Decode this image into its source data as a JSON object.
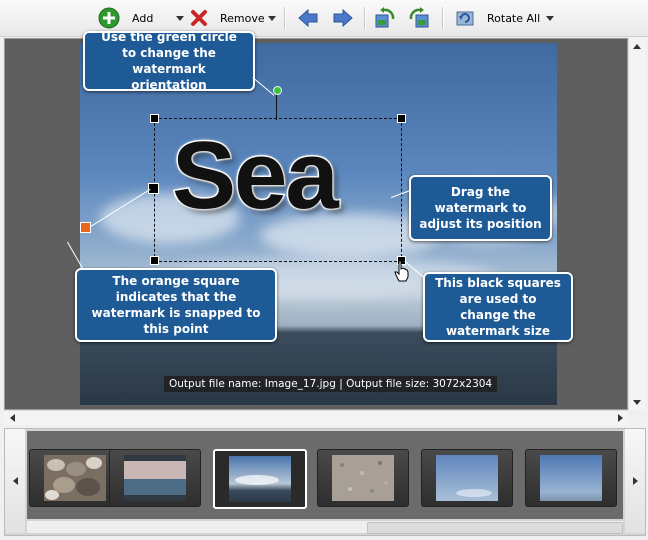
{
  "toolbar": {
    "add_label": "Add",
    "remove_label": "Remove",
    "rotate_all_label": "Rotate All"
  },
  "preview": {
    "watermark_text": "Sea",
    "info_text": "Output file name: Image_17.jpg | Output file size: 3072x2304"
  },
  "callouts": {
    "orientation": "Use the green circle to change the watermark orientation",
    "drag": "Drag the watermark to adjust its position",
    "snap": "The orange square indicates that the watermark is snapped to this point",
    "resize": "This black squares are used to change the watermark size"
  },
  "colors": {
    "callout_bg": "#1e5a96",
    "snap_point": "#e8661e",
    "rotation_handle": "#3fbf3f"
  },
  "filmstrip": {
    "thumbnails": [
      {
        "name": "pebbles",
        "selected": false
      },
      {
        "name": "sea-horizon",
        "selected": false
      },
      {
        "name": "sky-clouds-sea",
        "selected": true
      },
      {
        "name": "sand",
        "selected": false
      },
      {
        "name": "sky",
        "selected": false
      },
      {
        "name": "sky-horizon",
        "selected": false
      }
    ]
  }
}
